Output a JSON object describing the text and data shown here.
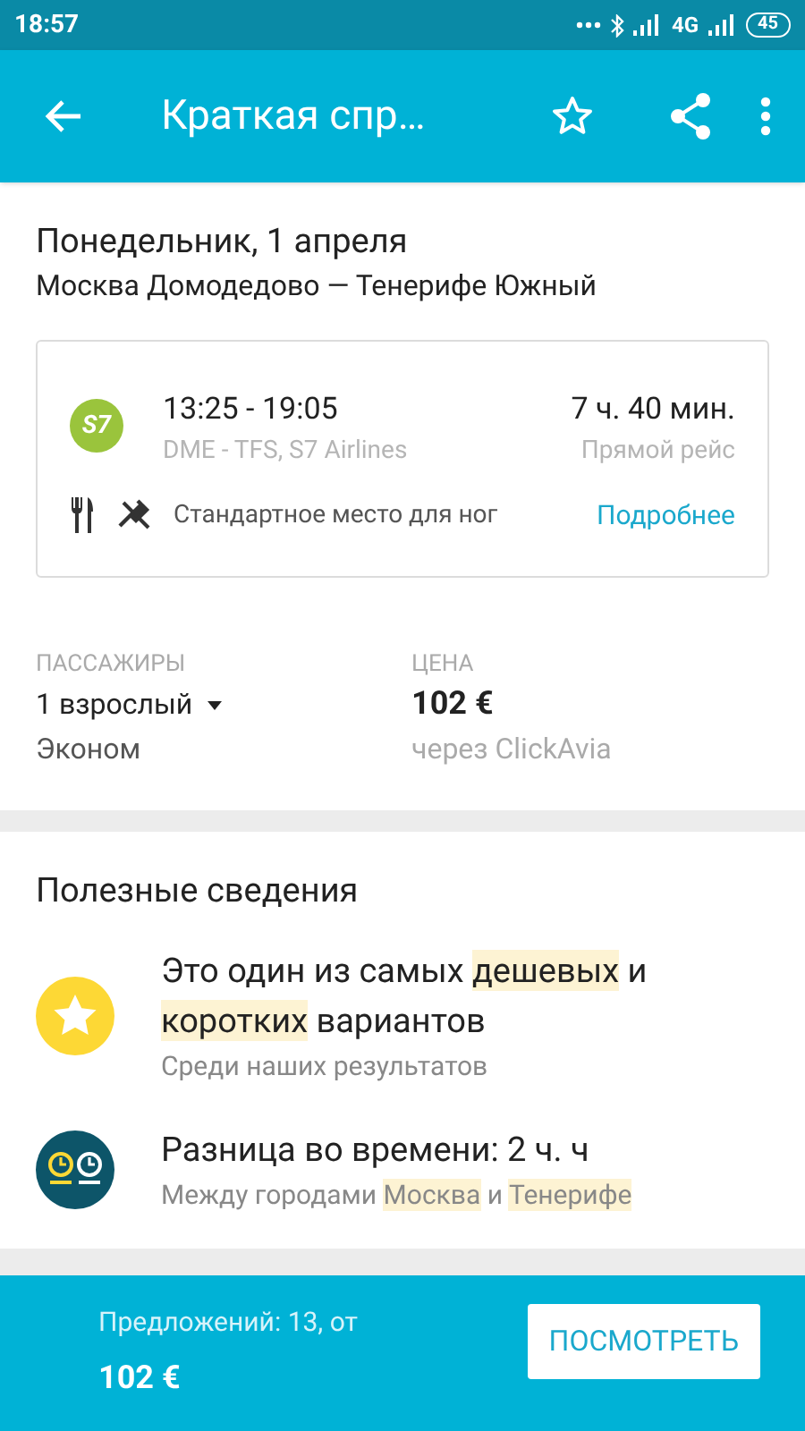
{
  "status_bar": {
    "time": "18:57",
    "network": "4G",
    "battery": "45"
  },
  "app_bar": {
    "title": "Краткая спр…"
  },
  "trip": {
    "date": "Понедельник, 1 апреля",
    "route": "Москва Домодедово — Тенерифе Южный"
  },
  "flight": {
    "airline_logo": "S7",
    "times": "13:25 - 19:05",
    "duration": "7 ч. 40 мин.",
    "details": "DME - TFS, S7 Airlines",
    "type": "Прямой рейс",
    "amenities": "Стандартное место для ног",
    "more_link": "Подробнее"
  },
  "passengers": {
    "label": "ПАССАЖИРЫ",
    "value": "1 взрослый",
    "class": "Эконом"
  },
  "price": {
    "label": "ЦЕНА",
    "value": "102 €",
    "source": "через ClickAvia"
  },
  "info": {
    "title": "Полезные сведения",
    "items": [
      {
        "kind": "star",
        "title": [
          {
            "text": "Это один из самых ",
            "highlighted": false
          },
          {
            "text": "дешевых",
            "highlighted": true
          },
          {
            "text": " и ",
            "highlighted": false
          },
          {
            "text": "коротких",
            "highlighted": true
          },
          {
            "text": " вариантов",
            "highlighted": false
          }
        ],
        "subtitle": [
          {
            "text": "Среди наших результатов",
            "highlighted": false
          }
        ]
      },
      {
        "kind": "clocks",
        "title": [
          {
            "text": "Разница во времени: 2 ч. ч",
            "highlighted": false
          }
        ],
        "subtitle": [
          {
            "text": "Между городами ",
            "highlighted": false
          },
          {
            "text": "Москва",
            "highlighted": true
          },
          {
            "text": " и ",
            "highlighted": false
          },
          {
            "text": "Тенерифе",
            "highlighted": true
          }
        ]
      }
    ]
  },
  "footer": {
    "offers": "Предложений: 13, от",
    "price": "102 €",
    "button": "ПОСМОТРЕТЬ"
  }
}
